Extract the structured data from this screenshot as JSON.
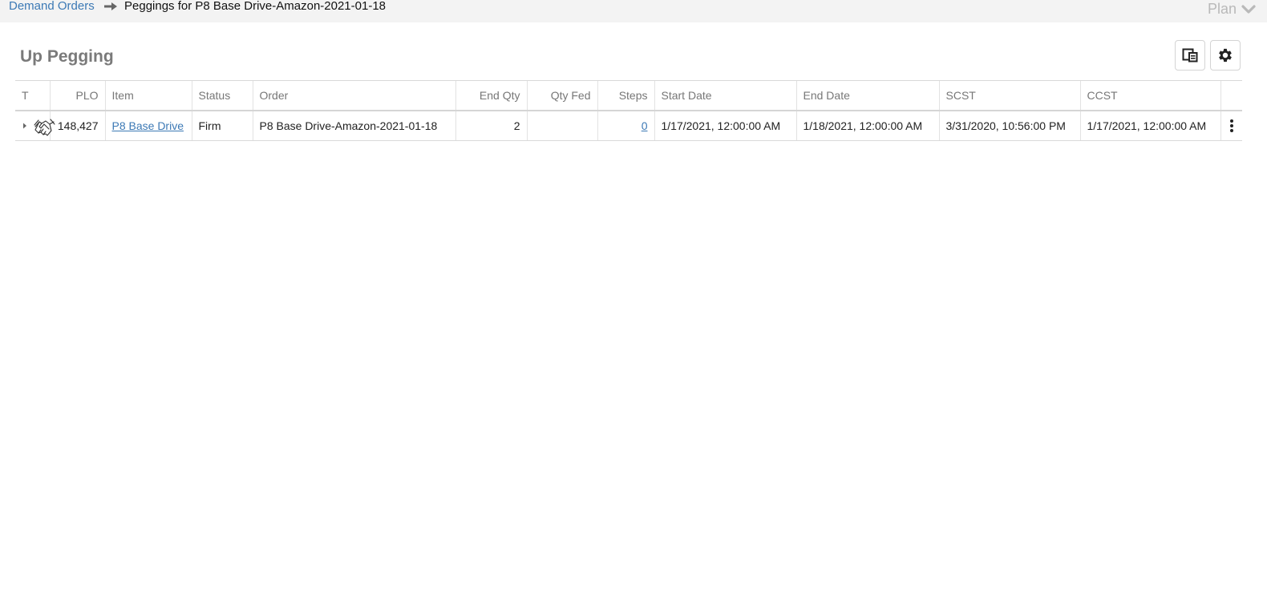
{
  "breadcrumb": {
    "parent_label": "Demand Orders",
    "current_label": "Peggings for P8 Base Drive-Amazon-2021-01-18"
  },
  "plan_menu": {
    "label": "Plan",
    "icon": "chevron-down-icon"
  },
  "section": {
    "title": "Up Pegging"
  },
  "toolbar": {
    "columns_icon": "column-chooser-icon",
    "settings_icon": "gear-icon"
  },
  "grid": {
    "columns": [
      "T",
      "PLO",
      "Item",
      "Status",
      "Order",
      "End Qty",
      "Qty Fed",
      "Steps",
      "Start Date",
      "End Date",
      "SCST",
      "CCST",
      ""
    ],
    "rows": [
      {
        "type_icon": "handshake-icon",
        "plo": "148,427",
        "item": "P8 Base Drive",
        "status": "Firm",
        "order": "P8 Base Drive-Amazon-2021-01-18",
        "end_qty": "2",
        "qty_fed": "",
        "steps": "0",
        "start_date": "1/17/2021, 12:00:00 AM",
        "end_date": "1/18/2021, 12:00:00 AM",
        "scst": "3/31/2020, 10:56:00 PM",
        "ccst": "1/17/2021, 12:00:00 AM",
        "actions_icon": "kebab-menu-icon"
      }
    ]
  },
  "colors": {
    "link": "#3c79b5",
    "header_text": "#777777",
    "title_text": "#7a7a7a",
    "topbar_bg": "#f3f3f3"
  }
}
